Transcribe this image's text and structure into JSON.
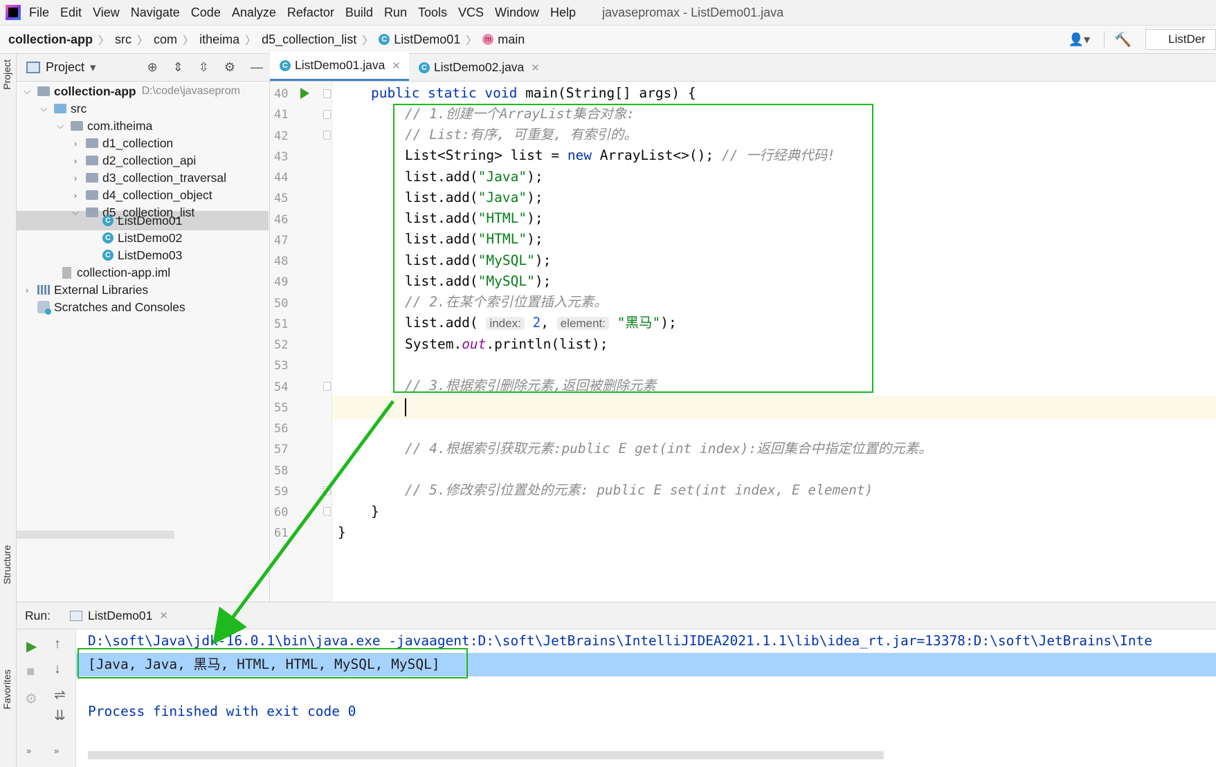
{
  "window_title": "javasepromax - ListDemo01.java",
  "menu": [
    "File",
    "Edit",
    "View",
    "Navigate",
    "Code",
    "Analyze",
    "Refactor",
    "Build",
    "Run",
    "Tools",
    "VCS",
    "Window",
    "Help"
  ],
  "breadcrumb": {
    "project": "collection-app",
    "items": [
      "src",
      "com",
      "itheima",
      "d5_collection_list"
    ],
    "class": "ListDemo01",
    "method": "main"
  },
  "right_toolbar": {
    "config_label": "ListDer"
  },
  "side_tabs": {
    "project": "Project",
    "structure": "Structure",
    "favorites": "Favorites"
  },
  "project_panel": {
    "title": "Project",
    "tree": {
      "root": "collection-app",
      "root_path": "D:\\code\\javaseprom",
      "src": "src",
      "pkg": "com.itheima",
      "folders": [
        "d1_collection",
        "d2_collection_api",
        "d3_collection_traversal",
        "d4_collection_object",
        "d5_collection_list"
      ],
      "files": [
        "ListDemo01",
        "ListDemo02",
        "ListDemo03"
      ],
      "iml": "collection-app.iml",
      "ext": "External Libraries",
      "scratch": "Scratches and Consoles"
    }
  },
  "editor": {
    "tabs": [
      "ListDemo01.java",
      "ListDemo02.java"
    ],
    "line_numbers": [
      "40",
      "41",
      "42",
      "43",
      "44",
      "45",
      "46",
      "47",
      "48",
      "49",
      "50",
      "51",
      "52",
      "53",
      "54",
      "55",
      "56",
      "57",
      "58",
      "59",
      "60",
      "61"
    ],
    "code": {
      "l40_kw": "public static void ",
      "l40_rest": "main(String[] args) {",
      "l41": "// 1.创建一个ArrayList集合对象:",
      "l42": "// List:有序, 可重复, 有索引的。",
      "l43_a": "List<String> list = ",
      "l43_kw": "new",
      "l43_b": " ArrayList<>(); ",
      "l43_c": "// 一行经典代码!",
      "adds": [
        {
          "pre": "list.add(",
          "val": "\"Java\"",
          "post": ");"
        },
        {
          "pre": "list.add(",
          "val": "\"Java\"",
          "post": ");"
        },
        {
          "pre": "list.add(",
          "val": "\"HTML\"",
          "post": ");"
        },
        {
          "pre": "list.add(",
          "val": "\"HTML\"",
          "post": ");"
        },
        {
          "pre": "list.add(",
          "val": "\"MySQL\"",
          "post": ");"
        },
        {
          "pre": "list.add(",
          "val": "\"MySQL\"",
          "post": ");"
        }
      ],
      "l50": "// 2.在某个索引位置插入元素。",
      "l51_pre": "list.add(",
      "l51_hint1": "index:",
      "l51_num": "2",
      "l51_comma": ", ",
      "l51_hint2": "element:",
      "l51_str": "\"黑马\"",
      "l51_post": ");",
      "l52_a": "System.",
      "l52_out": "out",
      "l52_b": ".println(list);",
      "l54": "// 3.根据索引删除元素,返回被删除元素",
      "l57": "// 4.根据索引获取元素:public E get(int index):返回集合中指定位置的元素。",
      "l59": "// 5.修改索引位置处的元素: public E set(int index, E element)",
      "l60": "}",
      "l61": "}"
    }
  },
  "run_panel": {
    "label": "Run:",
    "tab": "ListDemo01",
    "console": [
      "D:\\soft\\Java\\jdk-16.0.1\\bin\\java.exe -javaagent:D:\\soft\\JetBrains\\IntelliJIDEA2021.1.1\\lib\\idea_rt.jar=13378:D:\\soft\\JetBrains\\Inte",
      "[Java, Java, 黑马, HTML, HTML, MySQL, MySQL]",
      "Process finished with exit code 0"
    ]
  },
  "colors": {
    "annotation": "#1db91d",
    "selection": "#a6d2ff",
    "keyword": "#0033b3",
    "string": "#067d17",
    "comment": "#8c8c8c"
  }
}
